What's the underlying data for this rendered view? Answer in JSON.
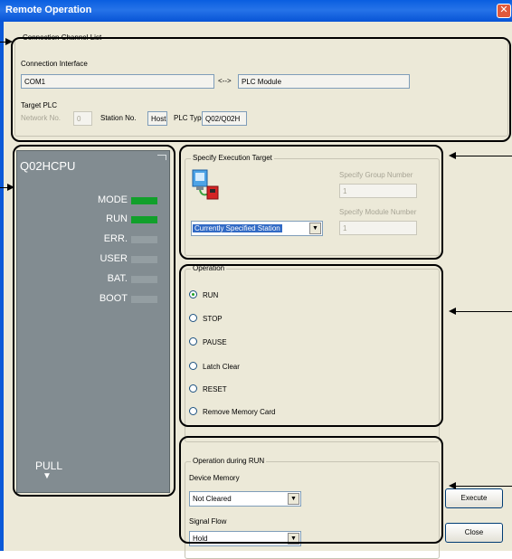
{
  "window": {
    "title": "Remote Operation"
  },
  "connection": {
    "legend": "Connection Channel List",
    "interface_label": "Connection Interface",
    "interface_value": "COM1",
    "arrow_text": "<-->",
    "plc_module": "PLC Module",
    "target_plc_label": "Target PLC",
    "network_no_label": "Network No.",
    "network_no_value": "0",
    "station_no_label": "Station No.",
    "station_no_value": "Host",
    "plc_type_label": "PLC Type",
    "plc_type_value": "Q02/Q02H"
  },
  "cpu_panel": {
    "model": "Q02HCPU",
    "leds": [
      {
        "label": "MODE",
        "on": true
      },
      {
        "label": "RUN",
        "on": true
      },
      {
        "label": "ERR.",
        "on": false
      },
      {
        "label": "USER",
        "on": false
      },
      {
        "label": "BAT.",
        "on": false
      },
      {
        "label": "BOOT",
        "on": false
      }
    ],
    "pull_label": "PULL",
    "pull_glyph": "▼"
  },
  "target": {
    "legend": "Specify Execution Target",
    "selected": "Currently Specified Station",
    "group_label": "Specify Group Number",
    "group_value": "1",
    "module_label": "Specify Module Number",
    "module_value": "1"
  },
  "operation": {
    "legend": "Operation",
    "options": [
      "RUN",
      "STOP",
      "PAUSE",
      "Latch Clear",
      "RESET",
      "Remove Memory Card"
    ],
    "selected_index": 0
  },
  "during_run": {
    "legend": "Operation during RUN",
    "device_memory_label": "Device Memory",
    "device_memory_value": "Not Cleared",
    "signal_flow_label": "Signal Flow",
    "signal_flow_value": "Hold"
  },
  "buttons": {
    "execute": "Execute",
    "close": "Close"
  },
  "icons": {
    "close": "close-icon",
    "dropdown": "dropdown-arrow-icon",
    "target": "plc-network-icon"
  },
  "colors": {
    "titlebar": "#0a5ee0",
    "led_on": "#11a02b",
    "panel": "#828c91"
  }
}
